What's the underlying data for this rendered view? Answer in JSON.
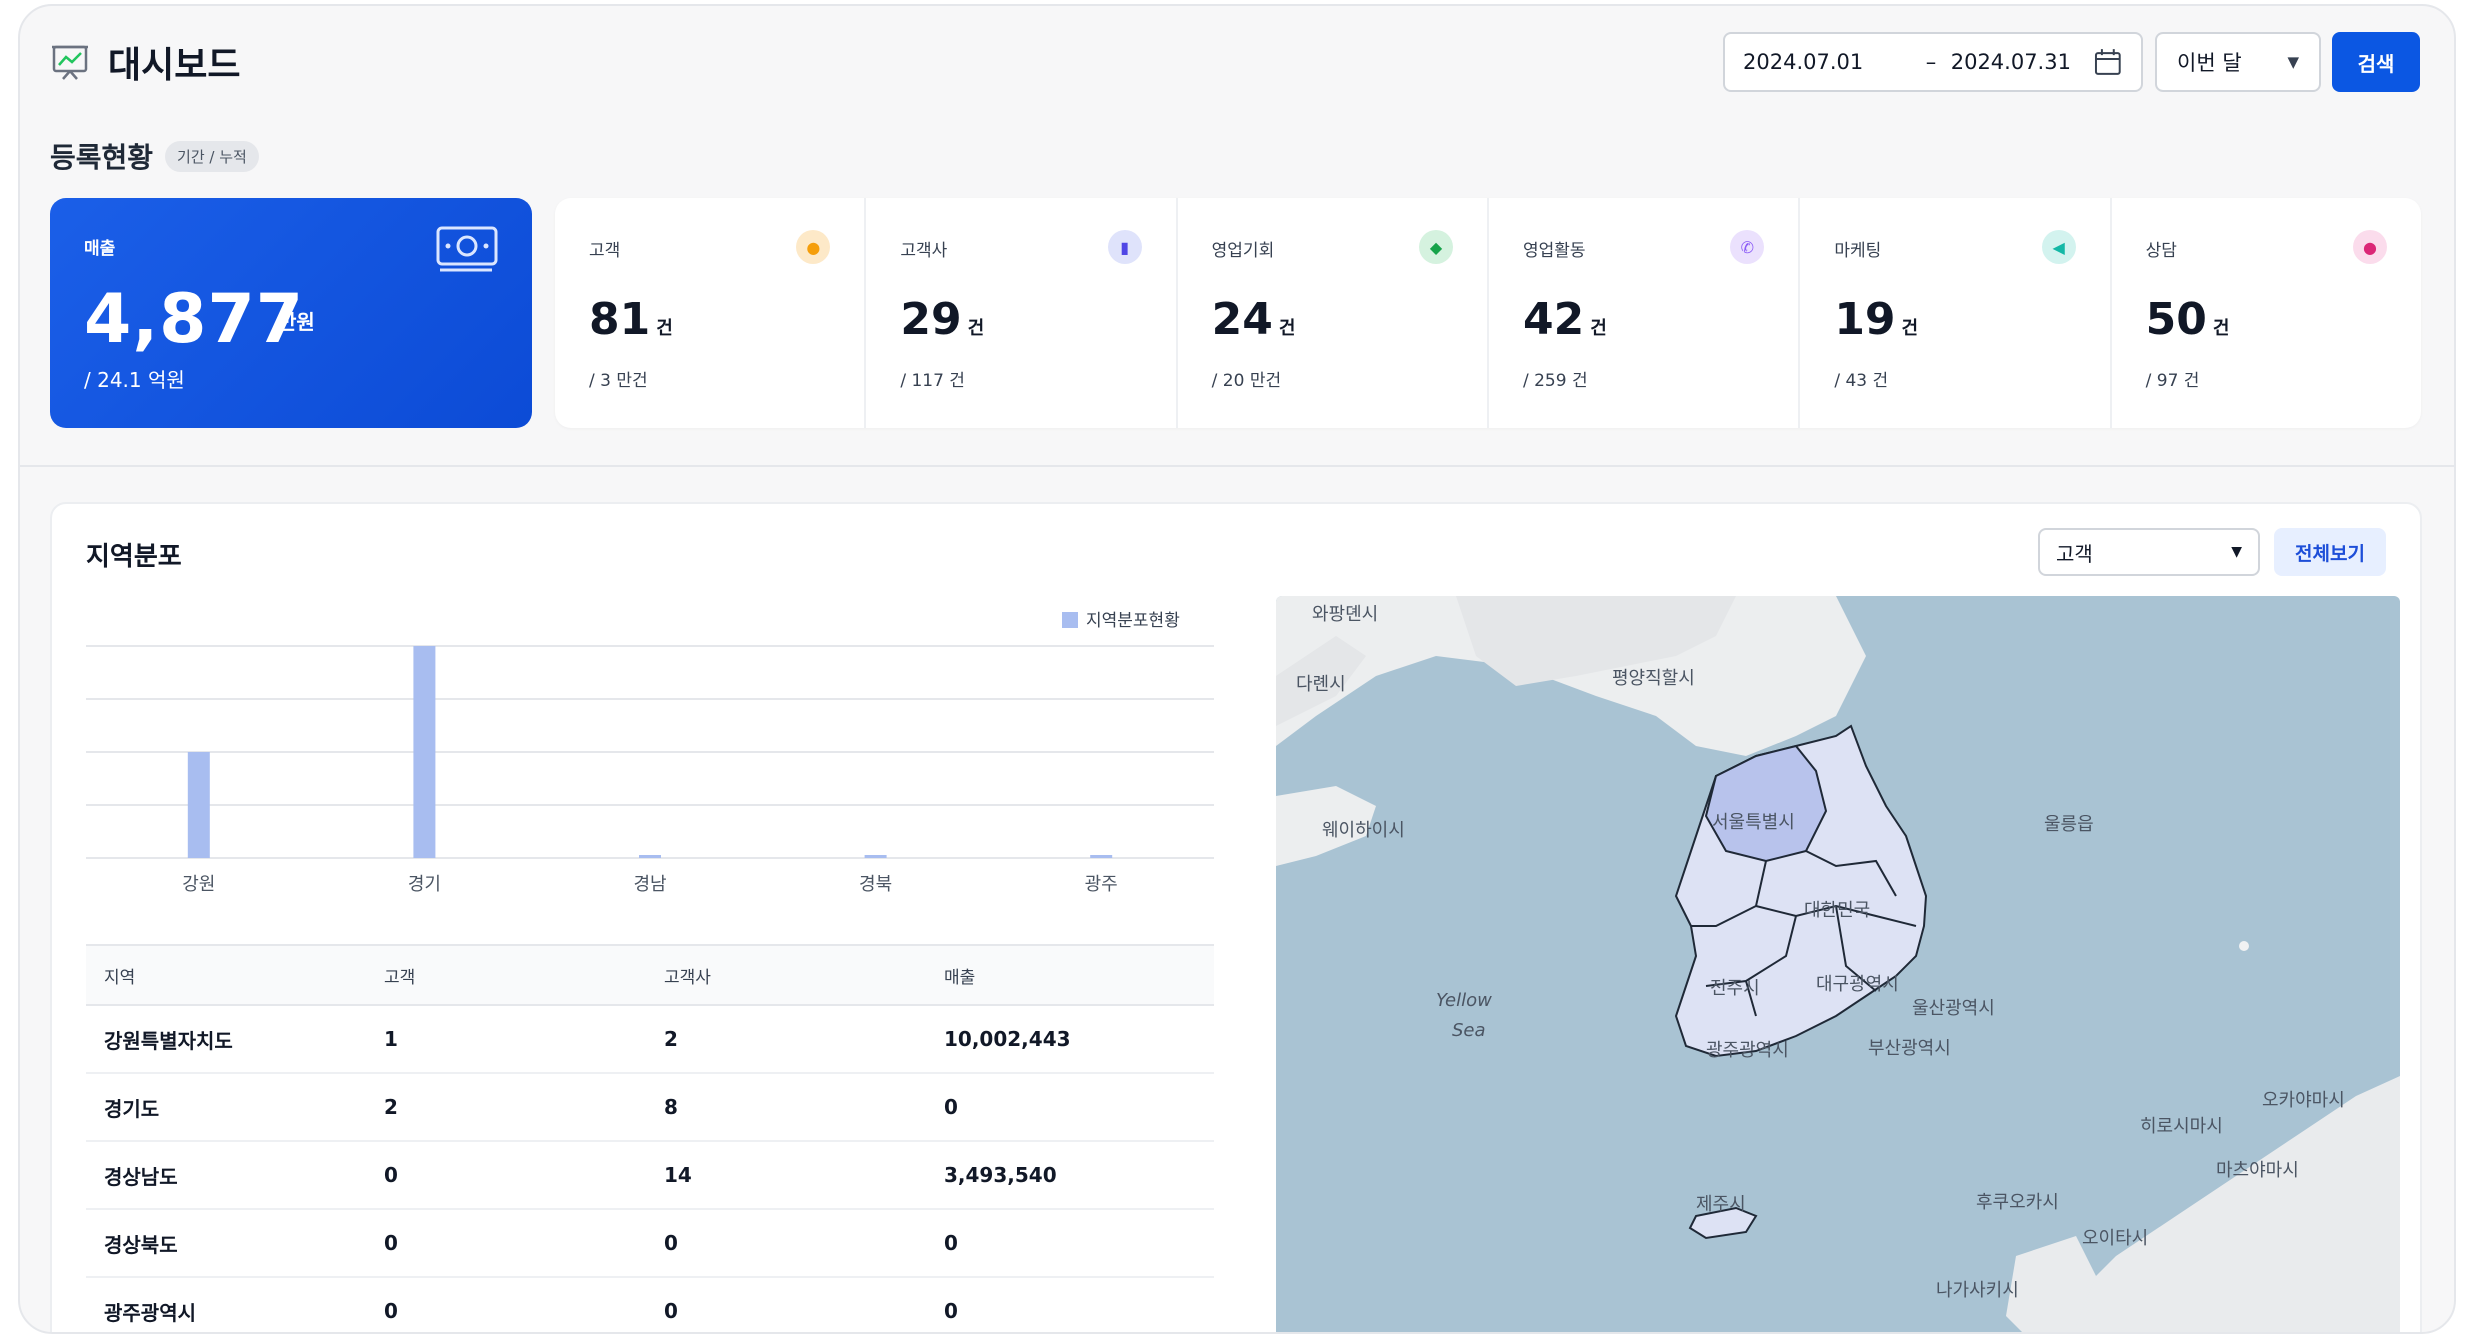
{
  "header": {
    "title": "대시보드",
    "date_from": "2024.07.01",
    "date_sep": "–",
    "date_to": "2024.07.31",
    "period": "이번 달",
    "search_label": "검색"
  },
  "registration": {
    "title": "등록현황",
    "badge": "기간 / 누적"
  },
  "revenue": {
    "label": "매출",
    "value": "4,877",
    "unit": "만원",
    "sub": "/ 24.1 억원"
  },
  "stats": [
    {
      "label": "고객",
      "value": "81",
      "unit": "건",
      "sub": "/ 3 만건",
      "icon": "person-icon",
      "color": "#f59e0b",
      "bg": "#fde9c8"
    },
    {
      "label": "고객사",
      "value": "29",
      "unit": "건",
      "sub": "/ 117 건",
      "icon": "building-icon",
      "color": "#4f46e5",
      "bg": "#dfe3fb"
    },
    {
      "label": "영업기회",
      "value": "24",
      "unit": "건",
      "sub": "/ 20 만건",
      "icon": "opportunity-icon",
      "color": "#16a34a",
      "bg": "#d5f2df"
    },
    {
      "label": "영업활동",
      "value": "42",
      "unit": "건",
      "sub": "/ 259 건",
      "icon": "phone-icon",
      "color": "#8b5cf6",
      "bg": "#ebe1fd"
    },
    {
      "label": "마케팅",
      "value": "19",
      "unit": "건",
      "sub": "/ 43 건",
      "icon": "megaphone-icon",
      "color": "#14b8a6",
      "bg": "#d3f3ef"
    },
    {
      "label": "상담",
      "value": "50",
      "unit": "건",
      "sub": "/ 97 건",
      "icon": "chat-icon",
      "color": "#db2777",
      "bg": "#fbdcec"
    }
  ],
  "region": {
    "title": "지역분포",
    "select": "고객",
    "view_all": "전체보기",
    "columns": [
      "지역",
      "고객",
      "고객사",
      "매출"
    ],
    "rows": [
      [
        "강원특별자치도",
        "1",
        "2",
        "10,002,443"
      ],
      [
        "경기도",
        "2",
        "8",
        "0"
      ],
      [
        "경상남도",
        "0",
        "14",
        "3,493,540"
      ],
      [
        "경상북도",
        "0",
        "0",
        "0"
      ],
      [
        "광주광역시",
        "0",
        "0",
        "0"
      ]
    ]
  },
  "chart_data": {
    "type": "bar",
    "categories": [
      "강원",
      "경기",
      "경남",
      "경북",
      "광주"
    ],
    "series": [
      {
        "name": "지역분포현황",
        "values": [
          1,
          2,
          0,
          0,
          0
        ]
      }
    ],
    "ylim": [
      0,
      2
    ],
    "grid": true,
    "legend": "top-right",
    "color": "#a8bdf0"
  },
  "map": {
    "labels": [
      "와팡뎬시",
      "다롄시",
      "평양직할시",
      "웨이하이시",
      "서울특별시",
      "대한민국",
      "울릉읍",
      "Yellow",
      "Sea",
      "전주시",
      "대구광역시",
      "울산광역시",
      "광주광역시",
      "부산광역시",
      "제주시",
      "후쿠오카시",
      "오이타시",
      "히로시마시",
      "오카야마시",
      "마츠야마시",
      "나가사키시"
    ]
  }
}
